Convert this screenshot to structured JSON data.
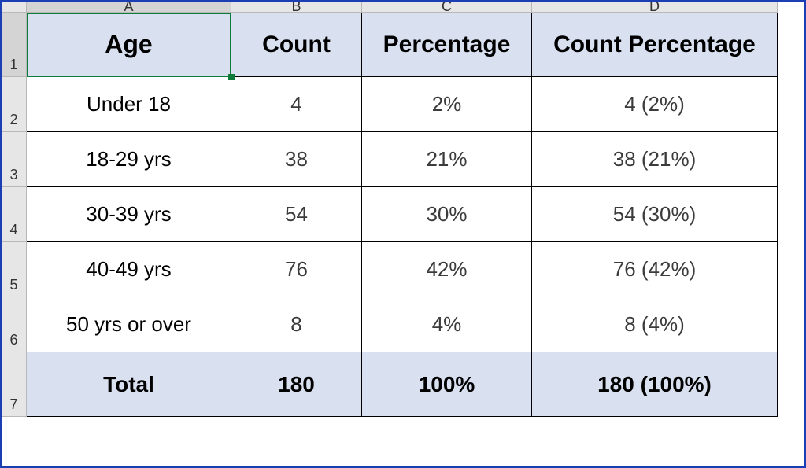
{
  "columns": [
    "A",
    "B",
    "C",
    "D"
  ],
  "rows": [
    "1",
    "2",
    "3",
    "4",
    "5",
    "6",
    "7"
  ],
  "headers": {
    "A": "Age",
    "B": "Count",
    "C": "Percentage",
    "D": "Count Percentage"
  },
  "data": [
    {
      "A": "Under 18",
      "B": "4",
      "C": "2%",
      "D": "4 (2%)"
    },
    {
      "A": "18-29 yrs",
      "B": "38",
      "C": "21%",
      "D": "38 (21%)"
    },
    {
      "A": "30-39 yrs",
      "B": "54",
      "C": "30%",
      "D": "54 (30%)"
    },
    {
      "A": "40-49 yrs",
      "B": "76",
      "C": "42%",
      "D": "76 (42%)"
    },
    {
      "A": "50 yrs or over",
      "B": "8",
      "C": "4%",
      "D": "8 (4%)"
    }
  ],
  "total": {
    "A": "Total",
    "B": "180",
    "C": "100%",
    "D": "180 (100%)"
  },
  "active_cell": "A1"
}
